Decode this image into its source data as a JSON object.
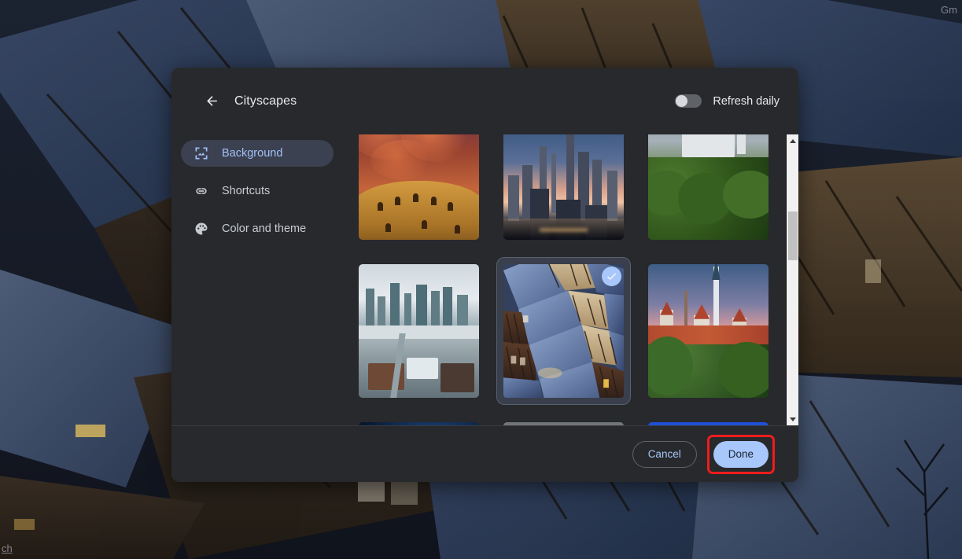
{
  "window": {
    "background_description": "Aerial view of a snowy half-timbered European village at dusk (dimmed new-tab page background)"
  },
  "newtab": {
    "gmail_link": "Gm",
    "customize_link_tail": "ch"
  },
  "dialog": {
    "title": "Cityscapes",
    "back_icon": "arrow-left-icon",
    "refresh": {
      "label": "Refresh daily",
      "enabled": false,
      "state_text": "off"
    },
    "sidebar": {
      "items": [
        {
          "label": "Background",
          "icon": "wallpaper-icon",
          "selected": true
        },
        {
          "label": "Shortcuts",
          "icon": "link-icon",
          "selected": false
        },
        {
          "label": "Color and theme",
          "icon": "palette-icon",
          "selected": false
        }
      ]
    },
    "grid": {
      "scroll_position": "partially scrolled",
      "tiles": [
        {
          "name": "colosseum-sunset",
          "selected": false,
          "row": 1
        },
        {
          "name": "city-skyline-dusk",
          "selected": false,
          "row": 1
        },
        {
          "name": "castle-in-forest",
          "selected": false,
          "row": 1
        },
        {
          "name": "winter-city-aerial",
          "selected": false,
          "row": 2
        },
        {
          "name": "half-timbered-village-snow",
          "selected": true,
          "row": 2
        },
        {
          "name": "tallinn-old-town",
          "selected": false,
          "row": 2
        },
        {
          "name": "starry-night-sky",
          "selected": false,
          "row": 3
        },
        {
          "name": "snowy-mountain-peak",
          "selected": false,
          "row": 3
        },
        {
          "name": "blue-sky",
          "selected": false,
          "row": 3
        }
      ],
      "selected_check_icon": "check-icon"
    },
    "scrollbar": {
      "up_arrow_icon": "triangle-up-icon",
      "down_arrow_icon": "triangle-down-icon"
    },
    "footer": {
      "cancel_label": "Cancel",
      "done_label": "Done",
      "done_highlighted": true
    }
  },
  "colors": {
    "dialog_bg": "#28292c",
    "accent_blue": "#a8c7fa",
    "selected_tile_bg": "#393f4c",
    "sidebar_active_bg": "#3b4150",
    "highlight_red": "#ef1c1c",
    "text_primary": "#e8eaed",
    "text_secondary": "#c8ccd2"
  }
}
